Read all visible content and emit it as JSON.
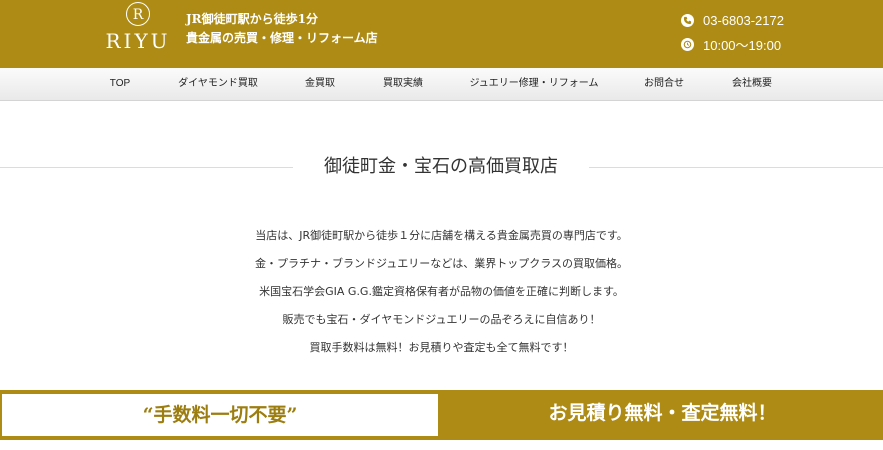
{
  "brand": {
    "logo_mark": "R",
    "logo_text": "RIYU"
  },
  "tagline": {
    "line1": "JR御徒町駅から徒歩1分",
    "line2": "貴金属の売買・修理・リフォーム店"
  },
  "contact": {
    "phone": "03-6803-2172",
    "hours": "10:00～19:00",
    "phone_icon": "phone-icon",
    "clock_icon": "clock-icon"
  },
  "nav": [
    {
      "label": "TOP"
    },
    {
      "label": "ダイヤモンド買取"
    },
    {
      "label": "金買取"
    },
    {
      "label": "買取実績"
    },
    {
      "label": "ジュエリー修理・リフォーム"
    },
    {
      "label": "お問合せ"
    },
    {
      "label": "会社概要"
    }
  ],
  "section": {
    "title": "御徒町金・宝石の高価買取店"
  },
  "intro": [
    "当店は、JR御徒町駅から徒歩１分に店舗を構える貴金属売買の専門店です。",
    "金・プラチナ・ブランドジュエリーなどは、業界トップクラスの買取価格。",
    "米国宝石学会GIA G.G.鑑定資格保有者が品物の価値を正確に判断します。",
    "販売でも宝石・ダイヤモンドジュエリーの品ぞろえに自信あり！",
    "買取手数料は無料！お見積りや査定も全て無料です！"
  ],
  "banners": {
    "left": "“手数料一切不要”",
    "right": "お見積り無料・査定無料！"
  },
  "colors": {
    "brand_gold": "#ad8b14",
    "nav_bg": "#efefef",
    "text": "#333333"
  }
}
